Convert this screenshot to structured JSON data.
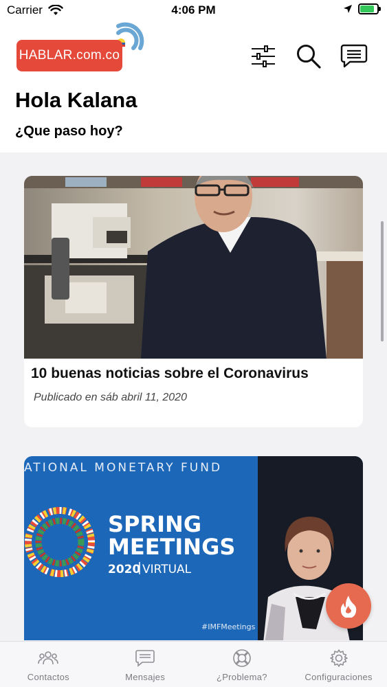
{
  "status": {
    "carrier": "Carrier",
    "time": "4:06 PM",
    "battery_level": 0.85
  },
  "header": {
    "logo_text": "HABLAR.com.co",
    "brand_color": "#e4493a",
    "signal_color": "#6aa7d4",
    "icons": [
      "filter-icon",
      "search-icon",
      "chat-icon"
    ]
  },
  "greeting": "Hola Kalana",
  "subtitle": "¿Que paso hoy?",
  "feed": {
    "cards": [
      {
        "title": "10 buenas noticias sobre el Coronavirus",
        "date": "Publicado en sáb abril 11, 2020"
      },
      {
        "image_text": {
          "banner": "ATIONAL MONETARY FUND",
          "headline_1": "SPRING",
          "headline_2": "MEETINGS",
          "year": "2020",
          "tag": "VIRTUAL",
          "hashtag": "#IMFMeetings"
        }
      }
    ]
  },
  "fab": {
    "color": "#e56a50",
    "icon": "fire-icon"
  },
  "tabs": [
    {
      "label": "Contactos",
      "icon": "contacts-icon"
    },
    {
      "label": "Mensajes",
      "icon": "messages-icon"
    },
    {
      "label": "¿Problema?",
      "icon": "lifebuoy-icon"
    },
    {
      "label": "Configuraciones",
      "icon": "gear-icon"
    }
  ]
}
